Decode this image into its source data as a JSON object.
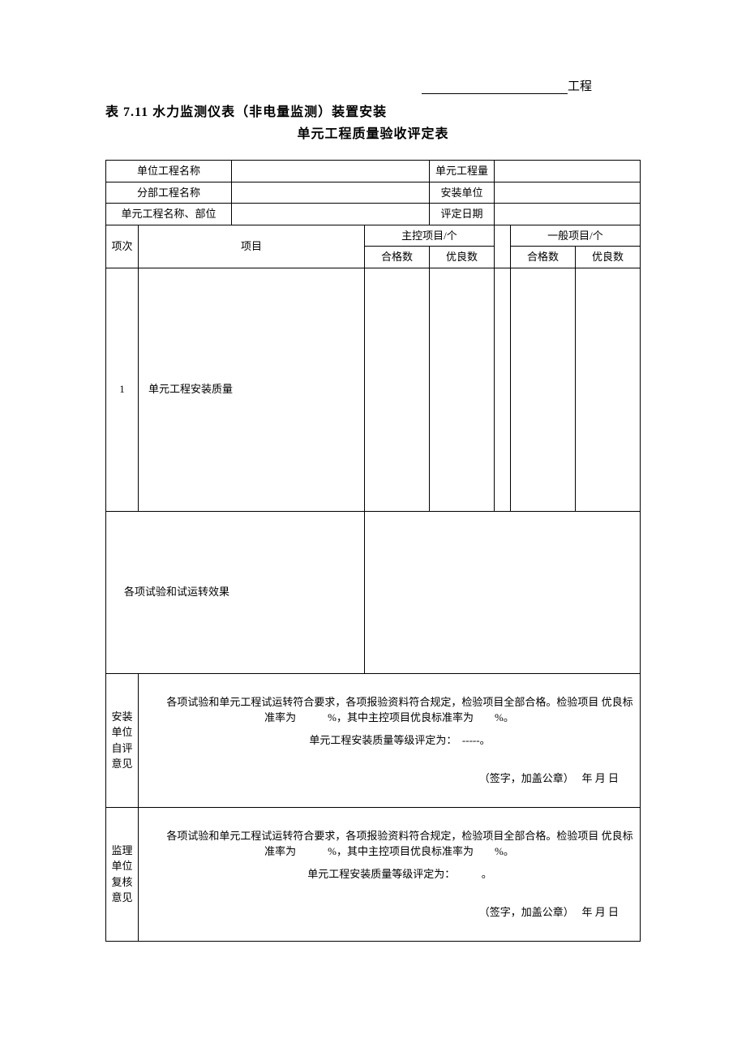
{
  "project_suffix": "工程",
  "title_prefix": "表 7.11",
  "title_line1": "水力监测仪表（非电量监测）装置安装",
  "title_line2": "单元工程质量验收评定表",
  "info": {
    "unit_project_name_label": "单位工程名称",
    "unit_project_name_value": "",
    "unit_quantity_label": "单元工程量",
    "unit_quantity_value": "",
    "division_name_label": "分部工程名称",
    "division_name_value": "",
    "install_unit_label": "安装单位",
    "install_unit_value": "",
    "unit_part_label": "单元工程名称、部位",
    "unit_part_value": "",
    "eval_date_label": "评定日期",
    "eval_date_value": ""
  },
  "headers": {
    "seq": "项次",
    "item": "项目",
    "main_items": "主控项目/个",
    "general_items": "一般项目/个",
    "qualified": "合格数",
    "excellent": "优良数"
  },
  "rows": {
    "row1_seq": "1",
    "row1_item": "单元工程安装质量",
    "row1_main_qualified": "",
    "row1_main_excellent": "",
    "row1_gen_qualified": "",
    "row1_gen_excellent": "",
    "trial_label": "各项试验和试运转效果",
    "trial_value": ""
  },
  "opinions": {
    "install_label": "安装单位自评意见",
    "install_p1": "各项试验和单元工程试运转符合要求，各项报验资料符合规定，检验项目全部合格。检验项目 优良标准率为　　　%，其中主控项目优良标准率为　　%。",
    "install_p2": "单元工程安装质量等级评定为：　-----。",
    "install_sig": "（签字，加盖公章）　 年  月  日",
    "supervise_label": "监理单位复核意见",
    "supervise_p1": "各项试验和单元工程试运转符合要求，各项报验资料符合规定，检验项目全部合格。检验项目 优良标准率为　　　%，其中主控项目优良标准率为　　%。",
    "supervise_p2": "单元工程安装质量等级评定为：　　　。",
    "supervise_sig": "（签字，加盖公章）　 年  月  日"
  }
}
